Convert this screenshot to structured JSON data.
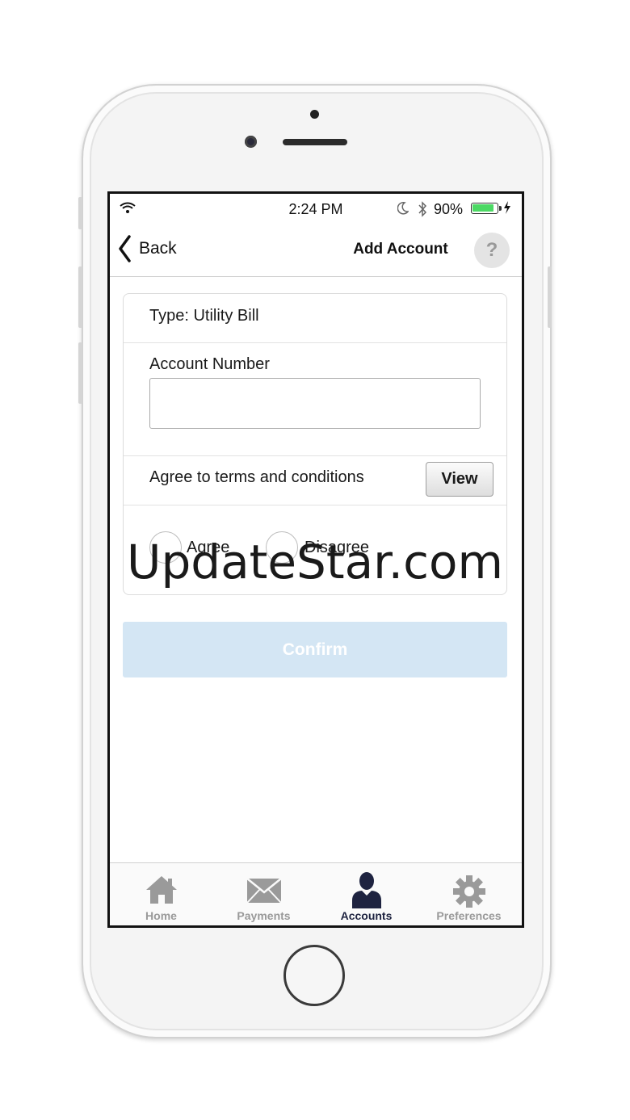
{
  "status_bar": {
    "time": "2:24 PM",
    "battery_percent": "90%"
  },
  "nav": {
    "back_label": "Back",
    "title": "Add Account",
    "help_label": "?"
  },
  "form": {
    "type_label": "Type: Utility Bill",
    "account_number_label": "Account Number",
    "account_number_value": "",
    "terms_label": "Agree to terms and conditions",
    "view_button": "View",
    "agree_label": "Agree",
    "disagree_label": "Disagree",
    "confirm_button": "Confirm"
  },
  "tabs": [
    {
      "label": "Home",
      "icon": "home-icon"
    },
    {
      "label": "Payments",
      "icon": "envelope-icon"
    },
    {
      "label": "Accounts",
      "icon": "user-icon",
      "active": true
    },
    {
      "label": "Preferences",
      "icon": "gear-icon"
    }
  ],
  "watermark": "UpdateStar.com",
  "colors": {
    "confirm_disabled": "#d4e6f4",
    "active_tab": "#1e2340",
    "battery": "#4cd964"
  }
}
